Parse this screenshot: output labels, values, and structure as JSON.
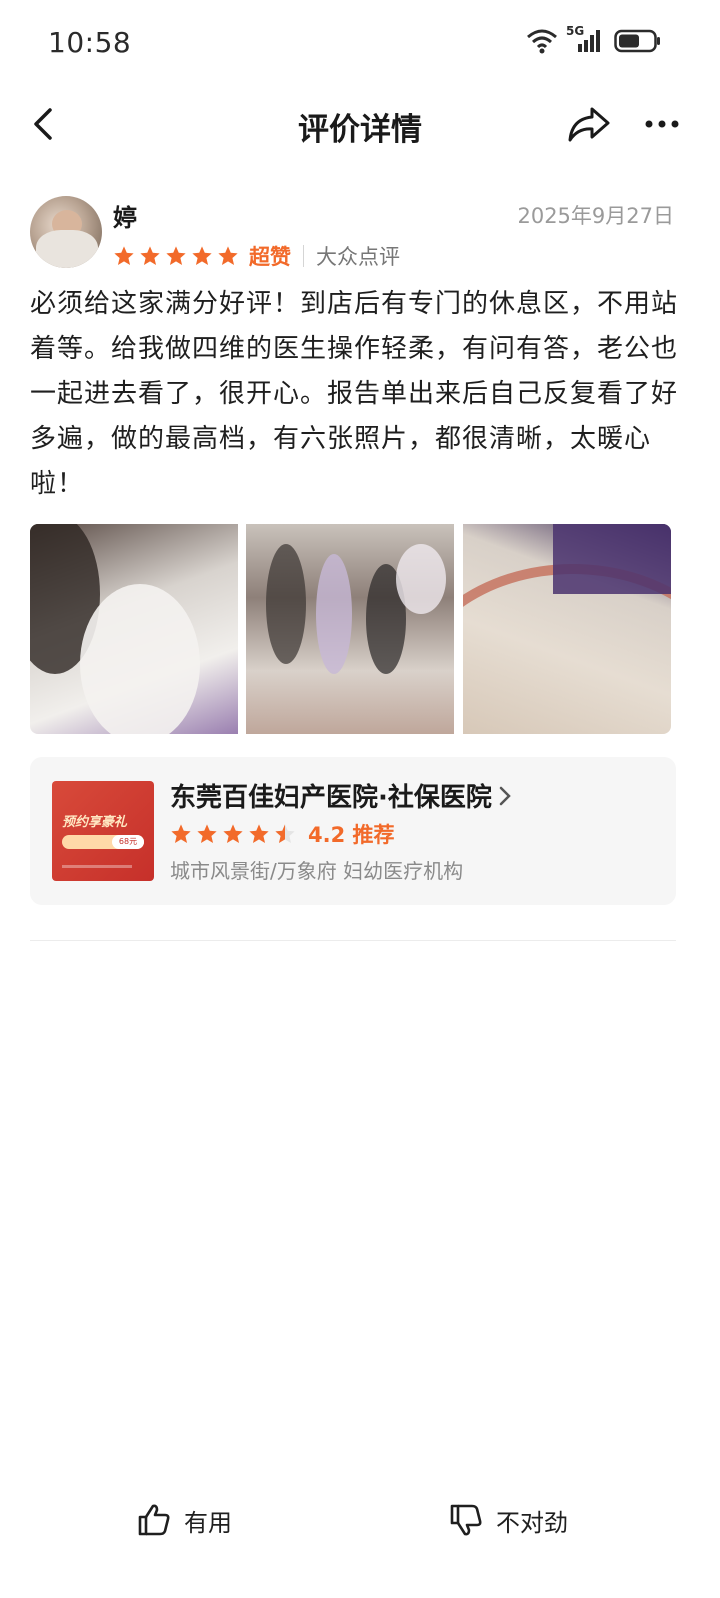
{
  "status_bar": {
    "time": "10:58",
    "network": "5G"
  },
  "nav": {
    "title": "评价详情"
  },
  "review": {
    "username": "婷",
    "date": "2025年9月27日",
    "stars": 5,
    "rating_label": "超赞",
    "source": "大众点评",
    "text": "必须给这家满分好评！到店后有专门的休息区，不用站着等。给我做四维的医生操作轻柔，有问有答，老公也一起进去看了，很开心。报告单出来后自己反复看了好多遍，做的最高档，有六张照片，都很清晰，太暖心啦！",
    "photos": [
      "review-photo-1",
      "review-photo-2",
      "review-photo-3"
    ]
  },
  "shop": {
    "name": "东莞百佳妇产医院·社保医院",
    "stars": 4.5,
    "score_text": "4.2 推荐",
    "location": "城市风景街/万象府 妇幼医疗机构",
    "thumb_promo": "预约享豪礼",
    "thumb_price": "68元"
  },
  "actions": {
    "helpful": "有用",
    "not_right": "不对劲"
  },
  "colors": {
    "accent": "#f26a2a",
    "text": "#1a1a1a",
    "muted": "#9a9a9a"
  }
}
